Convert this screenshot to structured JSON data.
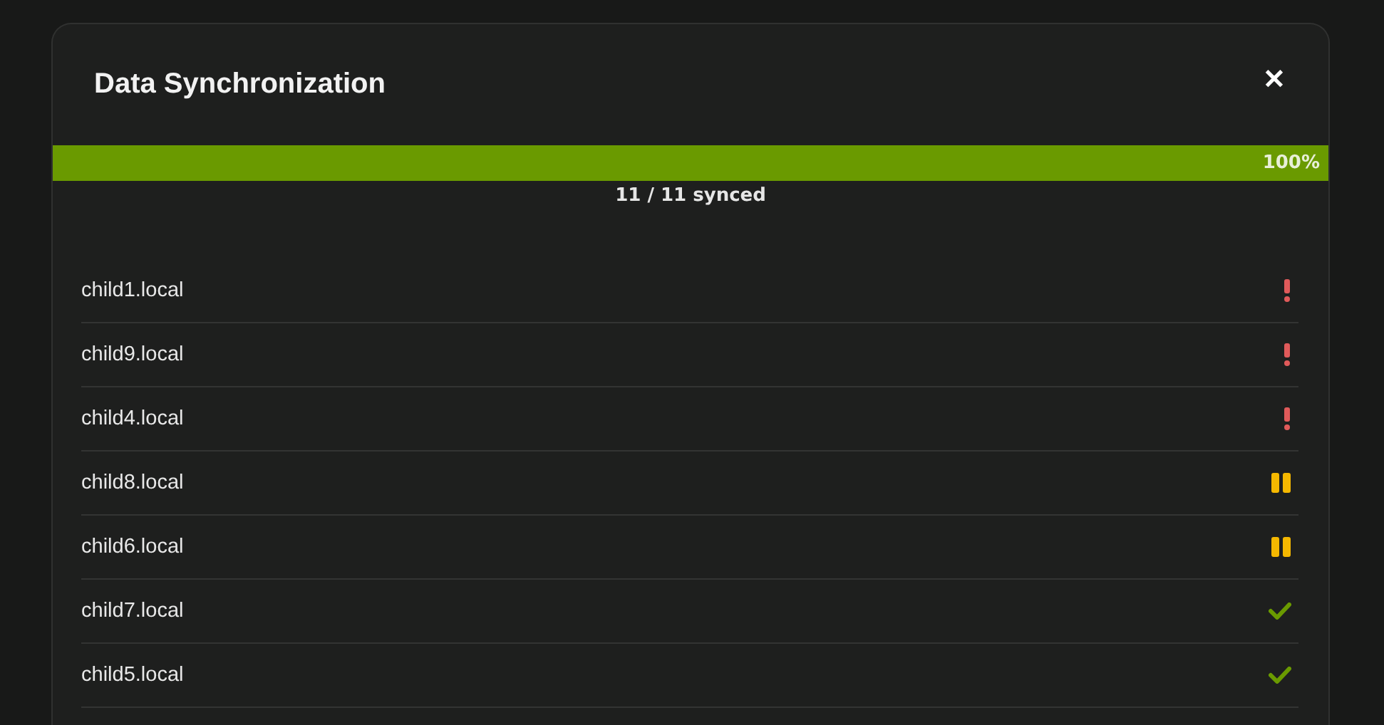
{
  "dialog": {
    "title": "Data Synchronization",
    "close": "✕"
  },
  "progress": {
    "level": 1,
    "reading": "100%",
    "summary": "11 / 11 synced"
  },
  "hosts": [
    {
      "name": "child1.local",
      "kind": "error"
    },
    {
      "name": "child9.local",
      "kind": "error"
    },
    {
      "name": "child4.local",
      "kind": "error"
    },
    {
      "name": "child8.local",
      "kind": "paused"
    },
    {
      "name": "child6.local",
      "kind": "paused"
    },
    {
      "name": "child7.local",
      "kind": "ok"
    },
    {
      "name": "child5.local",
      "kind": "ok"
    }
  ]
}
